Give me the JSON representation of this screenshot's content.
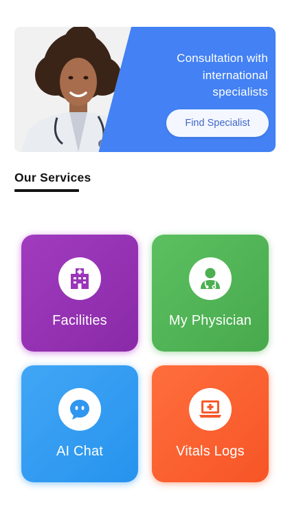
{
  "banner": {
    "line1": "Consultation with",
    "line2": "international",
    "line3": "specialists",
    "button_label": "Find Specialist",
    "accent_color": "#4381f4"
  },
  "services": {
    "title": "Our Services",
    "items": [
      {
        "label": "Facilities",
        "icon": "hospital-building-icon",
        "color": "#9b35b9"
      },
      {
        "label": "My Physician",
        "icon": "doctor-icon",
        "color": "#52b557"
      },
      {
        "label": "AI Chat",
        "icon": "chat-bubble-icon",
        "color": "#349cf1"
      },
      {
        "label": "Vitals Logs",
        "icon": "medical-monitor-icon",
        "color": "#fa5f30"
      }
    ]
  }
}
